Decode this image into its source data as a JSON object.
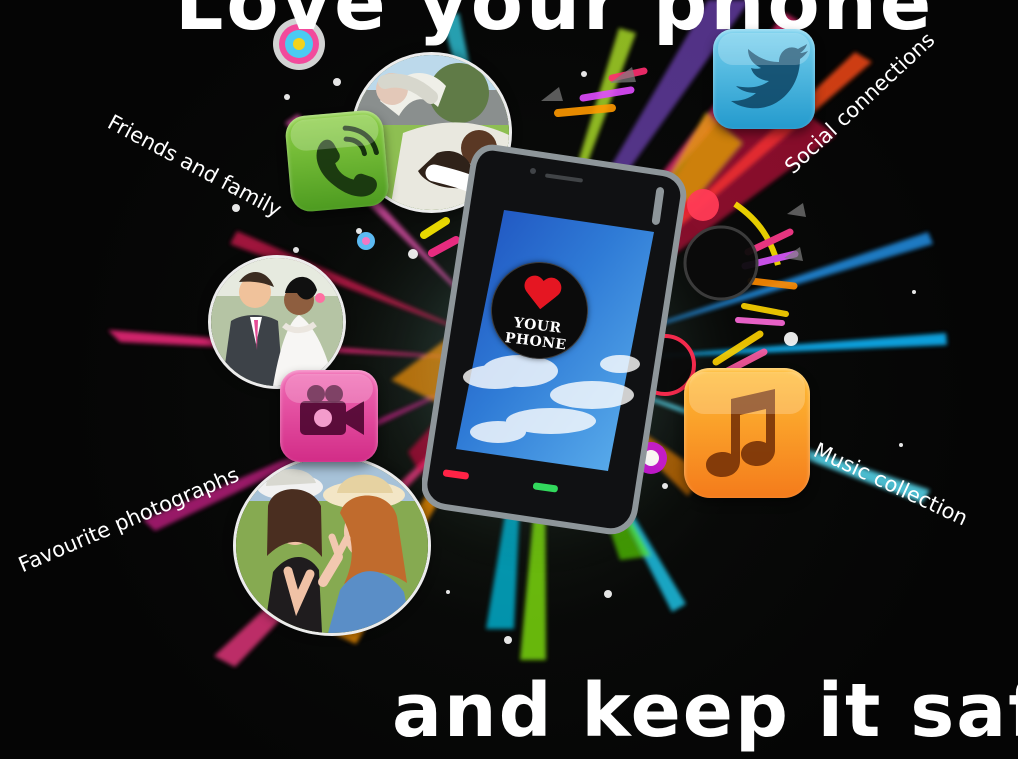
{
  "poster": {
    "headline_top": "Love your phone",
    "headline_bottom": "and keep it safe",
    "labels": {
      "friends": "Friends and family",
      "photos": "Favourite photographs",
      "social": "Social connections",
      "music": "Music collection"
    },
    "badge": {
      "line1": "YOUR",
      "line2": "PHONE"
    }
  },
  "icons": {
    "phone_app": "phone-call-icon",
    "camera_app": "video-camera-icon",
    "twitter_app": "bird-icon",
    "music_app": "music-note-icon",
    "badge": "heart-icon"
  },
  "colors": {
    "background": "#070807",
    "phone_app": "#6cbc33",
    "camera_app": "#e34da0",
    "twitter_app": "#44b2de",
    "music_app": "#f79625",
    "heart": "#e51622",
    "screen_sky": "#2f7bd6"
  }
}
